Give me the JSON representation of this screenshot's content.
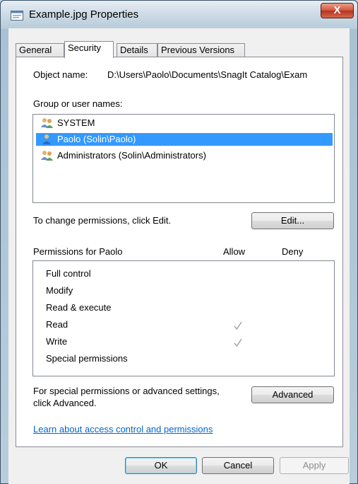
{
  "window": {
    "title": "Example.jpg Properties",
    "close_label": "X"
  },
  "tabs": [
    {
      "label": "General",
      "active": false
    },
    {
      "label": "Security",
      "active": true
    },
    {
      "label": "Details",
      "active": false
    },
    {
      "label": "Previous Versions",
      "active": false
    }
  ],
  "security": {
    "object_name_label": "Object name:",
    "object_name_value": "D:\\Users\\Paolo\\Documents\\SnagIt Catalog\\Exam",
    "group_label": "Group or user names:",
    "users": [
      {
        "name": "SYSTEM",
        "icon": "group-users-icon",
        "selected": false
      },
      {
        "name": "Paolo (Solin\\Paolo)",
        "icon": "user-icon",
        "selected": true
      },
      {
        "name": "Administrators (Solin\\Administrators)",
        "icon": "group-users-icon",
        "selected": false
      }
    ],
    "change_hint": "To change permissions, click Edit.",
    "edit_button": "Edit...",
    "permissions_for": "Permissions for Paolo",
    "allow_header": "Allow",
    "deny_header": "Deny",
    "permissions": [
      {
        "name": "Full control",
        "allow": false,
        "deny": false
      },
      {
        "name": "Modify",
        "allow": false,
        "deny": false
      },
      {
        "name": "Read & execute",
        "allow": false,
        "deny": false
      },
      {
        "name": "Read",
        "allow": true,
        "deny": false
      },
      {
        "name": "Write",
        "allow": true,
        "deny": false
      },
      {
        "name": "Special permissions",
        "allow": false,
        "deny": false
      }
    ],
    "special_hint_line1": "For special permissions or advanced settings,",
    "special_hint_line2": "click Advanced.",
    "advanced_button": "Advanced",
    "learn_link": "Learn about access control and permissions"
  },
  "footer": {
    "ok": "OK",
    "cancel": "Cancel",
    "apply": "Apply"
  },
  "colors": {
    "selection": "#3399ff",
    "link": "#0066cc",
    "check_gray": "#a0a0a0"
  }
}
